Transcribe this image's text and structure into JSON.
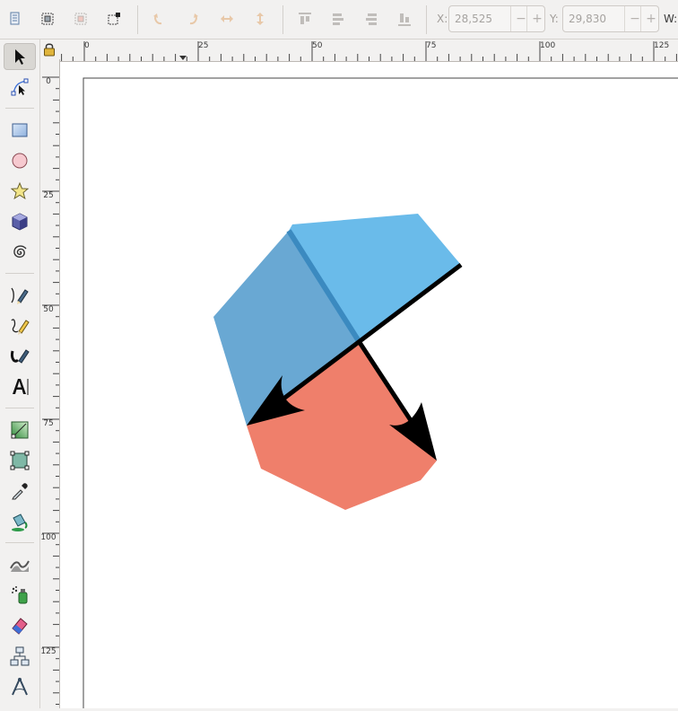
{
  "toolbar": {
    "x_label": "X:",
    "x_value": "28,525",
    "y_label": "Y:",
    "y_value": "29,830",
    "w_label": "W:",
    "spin_minus": "−",
    "spin_plus": "+"
  },
  "rulers": {
    "horizontal_labels": [
      "0",
      "25",
      "50",
      "75",
      "100",
      "125"
    ],
    "vertical_labels": [
      "0",
      "25",
      "50",
      "75",
      "100",
      "125"
    ]
  },
  "drawing": {
    "colors": {
      "blue_dark": "#69a8d3",
      "blue_light": "#6abbea",
      "salmon": "#ef7f6b",
      "blue_edge": "#3b8ac0",
      "arrows": "#000000"
    }
  }
}
